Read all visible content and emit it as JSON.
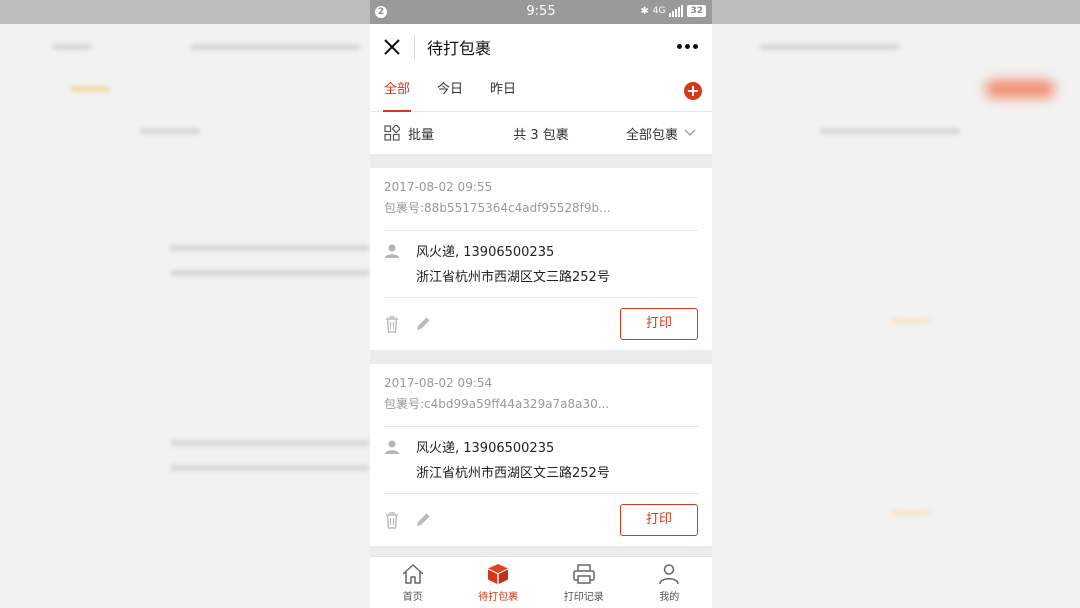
{
  "status_bar": {
    "notification_count": "2",
    "time": "9:55",
    "network": "4G",
    "battery": "32"
  },
  "header": {
    "title": "待打包裹"
  },
  "tabs": [
    {
      "label": "全部",
      "active": true
    },
    {
      "label": "今日",
      "active": false
    },
    {
      "label": "昨日",
      "active": false
    }
  ],
  "toolbar": {
    "batch_label": "批量",
    "count_text": "共 3 包裹",
    "filter_label": "全部包裹"
  },
  "orders": [
    {
      "date": "2017-08-02 09:55",
      "package_no": "包裹号:88b55175364c4adf95528f9b...",
      "recipient": "风火递, 13906500235",
      "address": "浙江省杭州市西湖区文三路252号",
      "print_label": "打印"
    },
    {
      "date": "2017-08-02 09:54",
      "package_no": "包裹号:c4bd99a59ff44a329a7a8a30...",
      "recipient": "风火递, 13906500235",
      "address": "浙江省杭州市西湖区文三路252号",
      "print_label": "打印"
    }
  ],
  "bottom_nav": [
    {
      "label": "首页",
      "icon": "home-icon",
      "active": false
    },
    {
      "label": "待打包裹",
      "icon": "package-icon",
      "active": true
    },
    {
      "label": "打印记录",
      "icon": "printer-icon",
      "active": false
    },
    {
      "label": "我的",
      "icon": "user-icon",
      "active": false
    }
  ],
  "colors": {
    "accent": "#d7381c",
    "status_bar": "#9a9a9a",
    "background": "#f2f2f2"
  }
}
